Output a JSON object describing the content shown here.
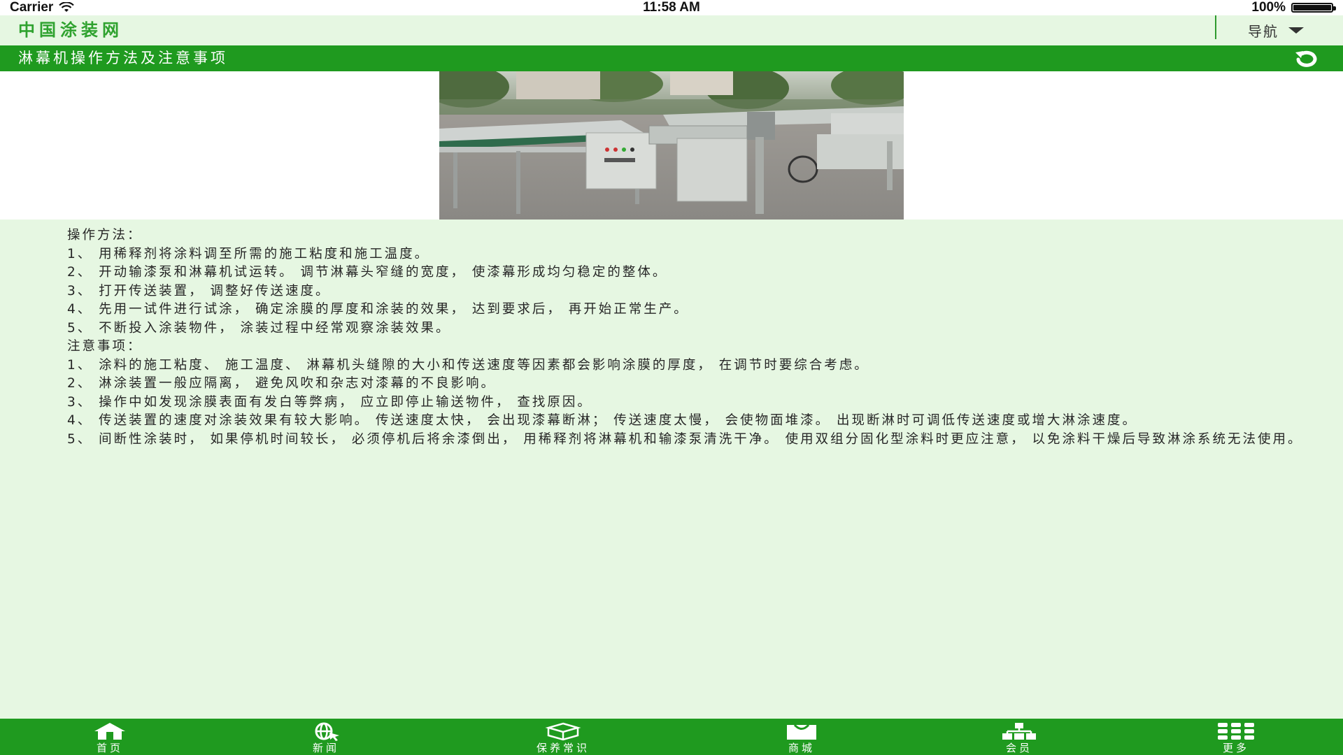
{
  "status_bar": {
    "carrier": "Carrier",
    "time": "11:58 AM",
    "battery_text": "100%",
    "battery_level": 1.0
  },
  "header": {
    "site_title": "中国涂装网",
    "nav_label": "导航"
  },
  "title_bar": {
    "title": "淋幕机操作方法及注意事项"
  },
  "article": {
    "paragraphs": [
      "操作方法：",
      "1、 用稀释剂将涂料调至所需的施工粘度和施工温度。",
      "2、 开动输漆泵和淋幕机试运转。 调节淋幕头窄缝的宽度， 使漆幕形成均匀稳定的整体。",
      "3、 打开传送装置， 调整好传送速度。",
      "4、 先用一试件进行试涂， 确定涂膜的厚度和涂装的效果， 达到要求后， 再开始正常生产。",
      "5、 不断投入涂装物件， 涂装过程中经常观察涂装效果。",
      "注意事项：",
      "1、 涂料的施工粘度、 施工温度、 淋幕机头缝隙的大小和传送速度等因素都会影响涂膜的厚度， 在调节时要综合考虑。",
      "2、 淋涂装置一般应隔离， 避免风吹和杂志对漆幕的不良影响。",
      "3、 操作中如发现涂膜表面有发白等弊病， 应立即停止输送物件， 查找原因。",
      "4、 传送装置的速度对涂装效果有较大影响。 传送速度太快， 会出现漆幕断淋； 传送速度太慢， 会使物面堆漆。 出现断淋时可调低传送速度或增大淋涂速度。",
      "5、 间断性涂装时， 如果停机时间较长， 必须停机后将余漆倒出， 用稀释剂将淋幕机和输漆泵清洗干净。 使用双组分固化型涂料时更应注意， 以免涂料干燥后导致淋涂系统无法使用。"
    ]
  },
  "tabs": [
    {
      "label": "首页",
      "icon": "home-icon"
    },
    {
      "label": "新闻",
      "icon": "globe-icon"
    },
    {
      "label": "保养常识",
      "icon": "box-icon"
    },
    {
      "label": "商城",
      "icon": "bag-icon"
    },
    {
      "label": "会员",
      "icon": "network-icon"
    },
    {
      "label": "更多",
      "icon": "grid-icon"
    }
  ],
  "colors": {
    "primary_green": "#1f9a1f",
    "title_green": "#2fa22f",
    "page_background": "#e6f7e2"
  }
}
